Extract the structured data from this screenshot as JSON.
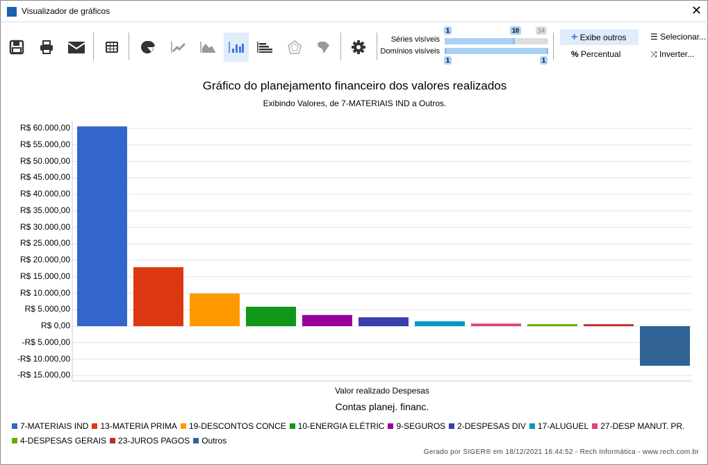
{
  "window": {
    "title": "Visualizador de gráficos",
    "close": "✕"
  },
  "toolbar": {
    "icons": [
      "save-icon",
      "print-icon",
      "email-icon",
      "table-icon",
      "pie-chart-icon",
      "line-chart-icon",
      "area-chart-icon",
      "bar-chart-icon",
      "horizontal-bar-chart-icon",
      "radar-chart-icon",
      "map-icon",
      "settings-icon"
    ],
    "active": "bar-chart-icon",
    "series_label": "Séries visíveis",
    "series_min": "1",
    "series_value": "10",
    "series_max": "14",
    "domains_label": "Domínios visíveis",
    "domains_min": "1",
    "domains_max": "1",
    "show_others": "Exibe outros",
    "percent": "Percentual",
    "select": "Selecionar...",
    "invert": "Inverter..."
  },
  "chart_data": {
    "type": "bar",
    "title": "Gráfico do planejamento financeiro dos valores realizados",
    "subtitle": "Exibindo Valores, de 7-MATERIAIS IND a Outros.",
    "categories": [
      "Valor realizado Despesas"
    ],
    "xlabel": "Contas planej. financ.",
    "ylim": [
      -17000,
      62000
    ],
    "yticks": [
      60000,
      55000,
      50000,
      45000,
      40000,
      35000,
      30000,
      25000,
      20000,
      15000,
      10000,
      5000,
      0,
      -5000,
      -10000,
      -15000
    ],
    "ytick_labels": [
      "R$ 60.000,00",
      "R$ 55.000,00",
      "R$ 50.000,00",
      "R$ 45.000,00",
      "R$ 40.000,00",
      "R$ 35.000,00",
      "R$ 30.000,00",
      "R$ 25.000,00",
      "R$ 20.000,00",
      "R$ 15.000,00",
      "R$ 10.000,00",
      "R$ 5.000,00",
      "R$ 0,00",
      "-R$ 5.000,00",
      "-R$ 10.000,00",
      "-R$ 15.000,00"
    ],
    "grid": true,
    "legend_position": "bottom",
    "series": [
      {
        "name": "7-MATERIAIS IND",
        "color": "#3366cc",
        "values": [
          60600
        ]
      },
      {
        "name": "13-MATERIA PRIMA",
        "color": "#dc3912",
        "values": [
          17900
        ]
      },
      {
        "name": "19-DESCONTOS CONCE",
        "color": "#ff9900",
        "values": [
          9900
        ]
      },
      {
        "name": "10-ENERGIA ELÉTRIC",
        "color": "#109618",
        "values": [
          5900
        ]
      },
      {
        "name": "9-SEGUROS",
        "color": "#990099",
        "values": [
          3400
        ]
      },
      {
        "name": "2-DESPESAS DIV",
        "color": "#3b3eac",
        "values": [
          2700
        ]
      },
      {
        "name": "17-ALUGUEL",
        "color": "#0099c6",
        "values": [
          1500
        ]
      },
      {
        "name": "27-DESP MANUT. PR.",
        "color": "#dd4477",
        "values": [
          800
        ]
      },
      {
        "name": "4-DESPESAS GERAIS",
        "color": "#66aa00",
        "values": [
          600
        ]
      },
      {
        "name": "23-JUROS PAGOS",
        "color": "#b82e2e",
        "values": [
          600
        ]
      },
      {
        "name": "Outros",
        "color": "#316395",
        "values": [
          -12000
        ]
      }
    ]
  },
  "footer": "Gerado por SIGER® em 18/12/2021 16:44:52 - Rech Informática - www.rech.com.br"
}
